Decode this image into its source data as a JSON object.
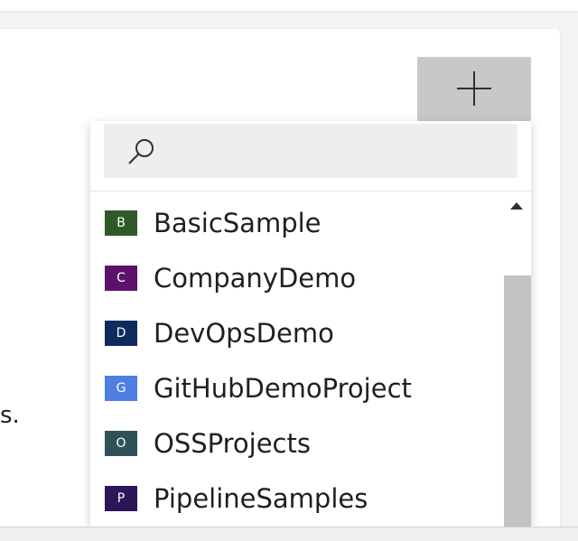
{
  "card": {
    "text_fragment": "s."
  },
  "add_button": {
    "icon": "plus-icon"
  },
  "search": {
    "icon": "search-icon",
    "value": ""
  },
  "projects": [
    {
      "initial": "B",
      "name": "BasicSample",
      "color": "#2e5a27"
    },
    {
      "initial": "C",
      "name": "CompanyDemo",
      "color": "#5c126b"
    },
    {
      "initial": "D",
      "name": "DevOpsDemo",
      "color": "#0f2a5c"
    },
    {
      "initial": "G",
      "name": "GitHubDemoProject",
      "color": "#4f7fe0"
    },
    {
      "initial": "O",
      "name": "OSSProjects",
      "color": "#2f5257"
    },
    {
      "initial": "P",
      "name": "PipelineSamples",
      "color": "#2b1659"
    }
  ]
}
